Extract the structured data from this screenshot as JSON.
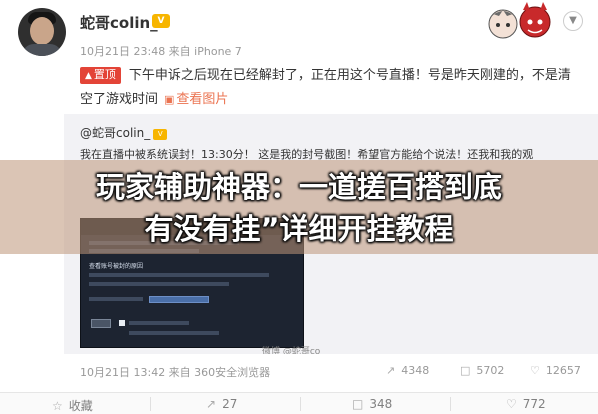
{
  "post": {
    "author": "蛇哥colin_",
    "meta": "10月21日 23:48 来自 iPhone 7",
    "pin_label": "置顶",
    "text": "下午申诉之后现在已经解封了，正在用这个号直播！号是昨天刚建的，不是清空了游戏时间",
    "view_pics": "查看图片"
  },
  "repost": {
    "author": "@蛇哥colin_",
    "text": "我在直播中被系统误封！13:30分！ 这是我的封号截图！希望官方能给个说法！还我和我的观",
    "screenshot_heading": "查看账号被封的原因",
    "watermark": "微博 @蛇哥co"
  },
  "overlay": {
    "line1": "玩家辅助神器：一道搓百搭到底",
    "line2": "有没有挂”详细开挂教程"
  },
  "footer": {
    "meta": "10月21日 13:42 来自 360安全浏览器",
    "stats": [
      {
        "icon": "share-icon",
        "value": "4348"
      },
      {
        "icon": "comment-icon",
        "value": "5702"
      },
      {
        "icon": "like-icon",
        "value": "12657"
      }
    ]
  },
  "action_bar": [
    {
      "icon": "star-icon",
      "label": "收藏"
    },
    {
      "icon": "share-icon",
      "label": "27"
    },
    {
      "icon": "comment-icon",
      "label": "348"
    },
    {
      "icon": "like-icon",
      "label": "772"
    }
  ],
  "colors": {
    "pin_badge": "#e34437",
    "link": "#eb7350",
    "vip": "#f7b500"
  }
}
